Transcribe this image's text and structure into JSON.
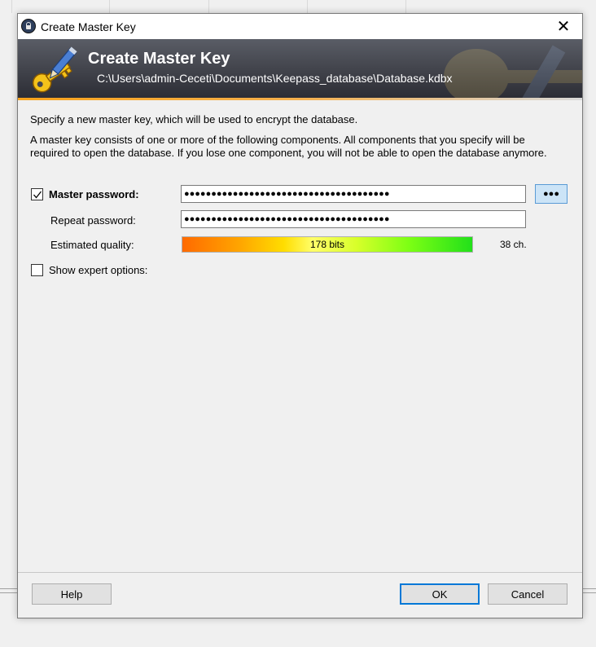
{
  "window": {
    "title": "Create Master Key",
    "close_glyph": "✕"
  },
  "banner": {
    "title": "Create Master Key",
    "path": "C:\\Users\\admin-Ceceti\\Documents\\Keepass_database\\Database.kdbx",
    "icon": "key-pen-icon"
  },
  "intro": {
    "line1": "Specify a new master key, which will be used to encrypt the database.",
    "line2": "A master key consists of one or more of the following components. All components that you specify will be",
    "line3": "required to open the database. If you lose one component, you will not be able to open the database anymore."
  },
  "form": {
    "master_password_label": "Master password:",
    "master_password_checked": true,
    "master_password_value": "●●●●●●●●●●●●●●●●●●●●●●●●●●●●●●●●●●●●●●",
    "show_password_glyph": "●●●",
    "repeat_password_label": "Repeat password:",
    "repeat_password_value": "●●●●●●●●●●●●●●●●●●●●●●●●●●●●●●●●●●●●●●",
    "quality_label": "Estimated quality:",
    "quality_text": "178 bits",
    "quality_fraction": 1.0,
    "char_count": "38 ch.",
    "expert_label": "Show expert options:",
    "expert_checked": false
  },
  "buttons": {
    "help": "Help",
    "ok": "OK",
    "cancel": "Cancel"
  },
  "colors": {
    "banner_accent": "#f7a21b",
    "default_button_border": "#0078d7"
  }
}
